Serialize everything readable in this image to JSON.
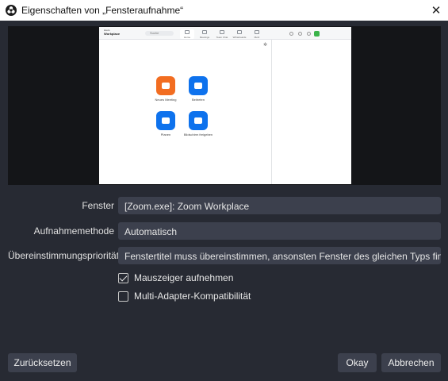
{
  "window": {
    "title": "Eigenschaften von „Fensteraufnahme“",
    "close_icon": "✕"
  },
  "preview": {
    "zoom_app": {
      "brand_line1": "zoom",
      "brand_line2": "Workplace",
      "search_text": "Suche",
      "nav": [
        "Home",
        "Meetings",
        "Team Chat",
        "Whiteboards",
        "Mehr"
      ],
      "tiles": [
        {
          "label": "Neues Meeting",
          "color": "#f26d21"
        },
        {
          "label": "Beitreten",
          "color": "#0e72ed"
        },
        {
          "label": "Planen",
          "color": "#0e72ed"
        },
        {
          "label": "Bildschirm freigeben",
          "color": "#0e72ed"
        }
      ]
    }
  },
  "form": {
    "fenster_label": "Fenster",
    "fenster_value": "[Zoom.exe]: Zoom Workplace",
    "methode_label": "Aufnahmemethode",
    "methode_value": "Automatisch",
    "prio_label": "Übereinstimmungspriorität",
    "prio_value": "Fenstertitel muss übereinstimmen, ansonsten Fenster des gleichen Typs finden",
    "cursor_label": "Mauszeiger aufnehmen",
    "cursor_checked": true,
    "multiadapter_label": "Multi-Adapter-Kompatibilität",
    "multiadapter_checked": false
  },
  "buttons": {
    "reset": "Zurücksetzen",
    "ok": "Okay",
    "cancel": "Abbrechen"
  },
  "colors": {
    "background": "#272a33",
    "field": "#3c404d",
    "preview_bg": "#141518"
  }
}
